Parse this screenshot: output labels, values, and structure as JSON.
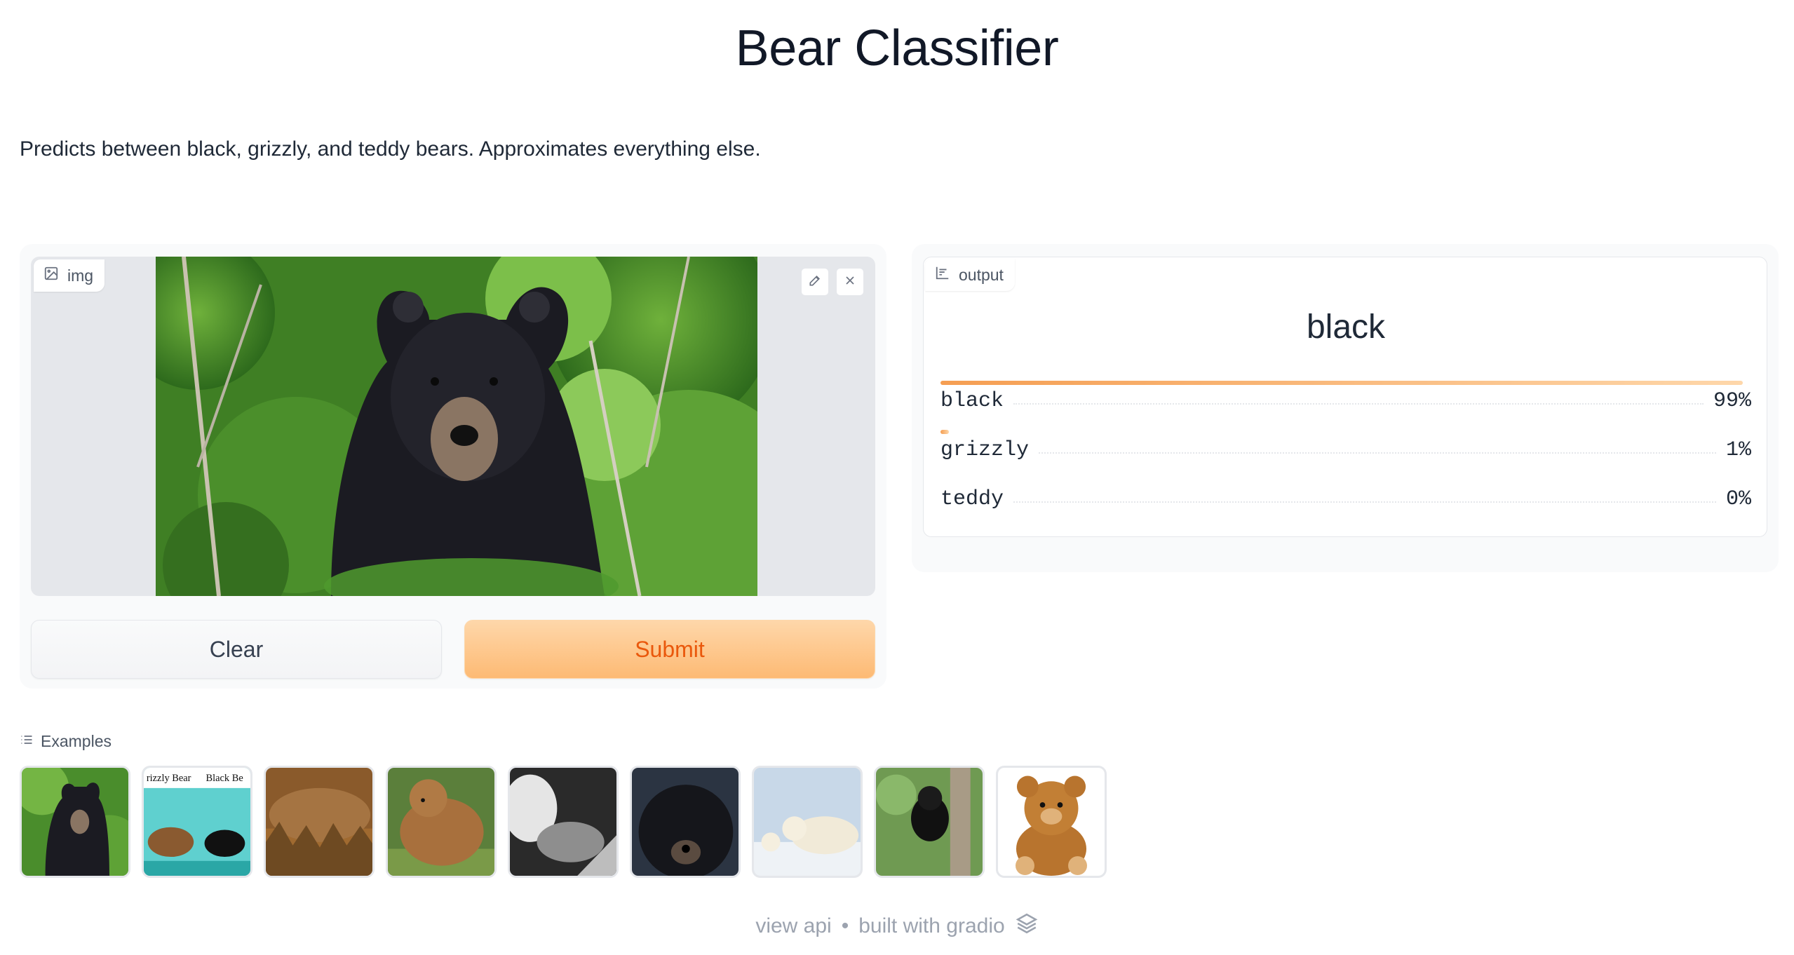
{
  "app": {
    "title": "Bear Classifier",
    "description": "Predicts between black, grizzly, and teddy bears. Approximates everything else."
  },
  "input": {
    "label": "img",
    "label_icon": "image-icon",
    "edit_icon": "pencil-icon",
    "clear_icon": "close-icon"
  },
  "actions": {
    "clear_label": "Clear",
    "submit_label": "Submit"
  },
  "output": {
    "label": "output",
    "label_icon": "bar-chart-icon",
    "prediction": "black",
    "confidences": [
      {
        "label": "black",
        "percent": "99%",
        "value": 0.99
      },
      {
        "label": "grizzly",
        "percent": "1%",
        "value": 0.01
      },
      {
        "label": "teddy",
        "percent": "0%",
        "value": 0.0
      }
    ]
  },
  "examples": {
    "label": "Examples",
    "label_icon": "list-icon",
    "count": 9
  },
  "footer": {
    "view_api": "view api",
    "separator": "•",
    "built_with": "built with gradio",
    "logo_icon": "gradio-logo-icon"
  },
  "colors": {
    "accent": "#f97316",
    "submit_bg": "#fdba74",
    "submit_text": "#ea580c"
  }
}
